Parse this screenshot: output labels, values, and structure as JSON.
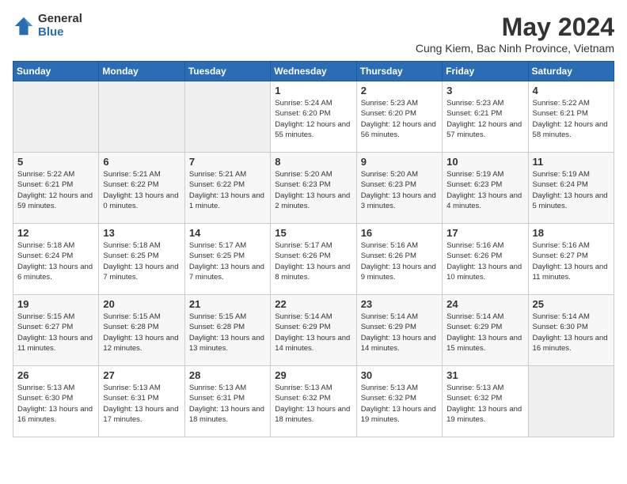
{
  "logo": {
    "general": "General",
    "blue": "Blue"
  },
  "title": {
    "month_year": "May 2024",
    "location": "Cung Kiem, Bac Ninh Province, Vietnam"
  },
  "days_of_week": [
    "Sunday",
    "Monday",
    "Tuesday",
    "Wednesday",
    "Thursday",
    "Friday",
    "Saturday"
  ],
  "weeks": [
    [
      {
        "day": "",
        "sunrise": "",
        "sunset": "",
        "daylight": "",
        "empty": true
      },
      {
        "day": "",
        "sunrise": "",
        "sunset": "",
        "daylight": "",
        "empty": true
      },
      {
        "day": "",
        "sunrise": "",
        "sunset": "",
        "daylight": "",
        "empty": true
      },
      {
        "day": "1",
        "sunrise": "Sunrise: 5:24 AM",
        "sunset": "Sunset: 6:20 PM",
        "daylight": "Daylight: 12 hours and 55 minutes."
      },
      {
        "day": "2",
        "sunrise": "Sunrise: 5:23 AM",
        "sunset": "Sunset: 6:20 PM",
        "daylight": "Daylight: 12 hours and 56 minutes."
      },
      {
        "day": "3",
        "sunrise": "Sunrise: 5:23 AM",
        "sunset": "Sunset: 6:21 PM",
        "daylight": "Daylight: 12 hours and 57 minutes."
      },
      {
        "day": "4",
        "sunrise": "Sunrise: 5:22 AM",
        "sunset": "Sunset: 6:21 PM",
        "daylight": "Daylight: 12 hours and 58 minutes."
      }
    ],
    [
      {
        "day": "5",
        "sunrise": "Sunrise: 5:22 AM",
        "sunset": "Sunset: 6:21 PM",
        "daylight": "Daylight: 12 hours and 59 minutes."
      },
      {
        "day": "6",
        "sunrise": "Sunrise: 5:21 AM",
        "sunset": "Sunset: 6:22 PM",
        "daylight": "Daylight: 13 hours and 0 minutes."
      },
      {
        "day": "7",
        "sunrise": "Sunrise: 5:21 AM",
        "sunset": "Sunset: 6:22 PM",
        "daylight": "Daylight: 13 hours and 1 minute."
      },
      {
        "day": "8",
        "sunrise": "Sunrise: 5:20 AM",
        "sunset": "Sunset: 6:23 PM",
        "daylight": "Daylight: 13 hours and 2 minutes."
      },
      {
        "day": "9",
        "sunrise": "Sunrise: 5:20 AM",
        "sunset": "Sunset: 6:23 PM",
        "daylight": "Daylight: 13 hours and 3 minutes."
      },
      {
        "day": "10",
        "sunrise": "Sunrise: 5:19 AM",
        "sunset": "Sunset: 6:23 PM",
        "daylight": "Daylight: 13 hours and 4 minutes."
      },
      {
        "day": "11",
        "sunrise": "Sunrise: 5:19 AM",
        "sunset": "Sunset: 6:24 PM",
        "daylight": "Daylight: 13 hours and 5 minutes."
      }
    ],
    [
      {
        "day": "12",
        "sunrise": "Sunrise: 5:18 AM",
        "sunset": "Sunset: 6:24 PM",
        "daylight": "Daylight: 13 hours and 6 minutes."
      },
      {
        "day": "13",
        "sunrise": "Sunrise: 5:18 AM",
        "sunset": "Sunset: 6:25 PM",
        "daylight": "Daylight: 13 hours and 7 minutes."
      },
      {
        "day": "14",
        "sunrise": "Sunrise: 5:17 AM",
        "sunset": "Sunset: 6:25 PM",
        "daylight": "Daylight: 13 hours and 7 minutes."
      },
      {
        "day": "15",
        "sunrise": "Sunrise: 5:17 AM",
        "sunset": "Sunset: 6:26 PM",
        "daylight": "Daylight: 13 hours and 8 minutes."
      },
      {
        "day": "16",
        "sunrise": "Sunrise: 5:16 AM",
        "sunset": "Sunset: 6:26 PM",
        "daylight": "Daylight: 13 hours and 9 minutes."
      },
      {
        "day": "17",
        "sunrise": "Sunrise: 5:16 AM",
        "sunset": "Sunset: 6:26 PM",
        "daylight": "Daylight: 13 hours and 10 minutes."
      },
      {
        "day": "18",
        "sunrise": "Sunrise: 5:16 AM",
        "sunset": "Sunset: 6:27 PM",
        "daylight": "Daylight: 13 hours and 11 minutes."
      }
    ],
    [
      {
        "day": "19",
        "sunrise": "Sunrise: 5:15 AM",
        "sunset": "Sunset: 6:27 PM",
        "daylight": "Daylight: 13 hours and 11 minutes."
      },
      {
        "day": "20",
        "sunrise": "Sunrise: 5:15 AM",
        "sunset": "Sunset: 6:28 PM",
        "daylight": "Daylight: 13 hours and 12 minutes."
      },
      {
        "day": "21",
        "sunrise": "Sunrise: 5:15 AM",
        "sunset": "Sunset: 6:28 PM",
        "daylight": "Daylight: 13 hours and 13 minutes."
      },
      {
        "day": "22",
        "sunrise": "Sunrise: 5:14 AM",
        "sunset": "Sunset: 6:29 PM",
        "daylight": "Daylight: 13 hours and 14 minutes."
      },
      {
        "day": "23",
        "sunrise": "Sunrise: 5:14 AM",
        "sunset": "Sunset: 6:29 PM",
        "daylight": "Daylight: 13 hours and 14 minutes."
      },
      {
        "day": "24",
        "sunrise": "Sunrise: 5:14 AM",
        "sunset": "Sunset: 6:29 PM",
        "daylight": "Daylight: 13 hours and 15 minutes."
      },
      {
        "day": "25",
        "sunrise": "Sunrise: 5:14 AM",
        "sunset": "Sunset: 6:30 PM",
        "daylight": "Daylight: 13 hours and 16 minutes."
      }
    ],
    [
      {
        "day": "26",
        "sunrise": "Sunrise: 5:13 AM",
        "sunset": "Sunset: 6:30 PM",
        "daylight": "Daylight: 13 hours and 16 minutes."
      },
      {
        "day": "27",
        "sunrise": "Sunrise: 5:13 AM",
        "sunset": "Sunset: 6:31 PM",
        "daylight": "Daylight: 13 hours and 17 minutes."
      },
      {
        "day": "28",
        "sunrise": "Sunrise: 5:13 AM",
        "sunset": "Sunset: 6:31 PM",
        "daylight": "Daylight: 13 hours and 18 minutes."
      },
      {
        "day": "29",
        "sunrise": "Sunrise: 5:13 AM",
        "sunset": "Sunset: 6:32 PM",
        "daylight": "Daylight: 13 hours and 18 minutes."
      },
      {
        "day": "30",
        "sunrise": "Sunrise: 5:13 AM",
        "sunset": "Sunset: 6:32 PM",
        "daylight": "Daylight: 13 hours and 19 minutes."
      },
      {
        "day": "31",
        "sunrise": "Sunrise: 5:13 AM",
        "sunset": "Sunset: 6:32 PM",
        "daylight": "Daylight: 13 hours and 19 minutes."
      },
      {
        "day": "",
        "sunrise": "",
        "sunset": "",
        "daylight": "",
        "empty": true
      }
    ]
  ]
}
